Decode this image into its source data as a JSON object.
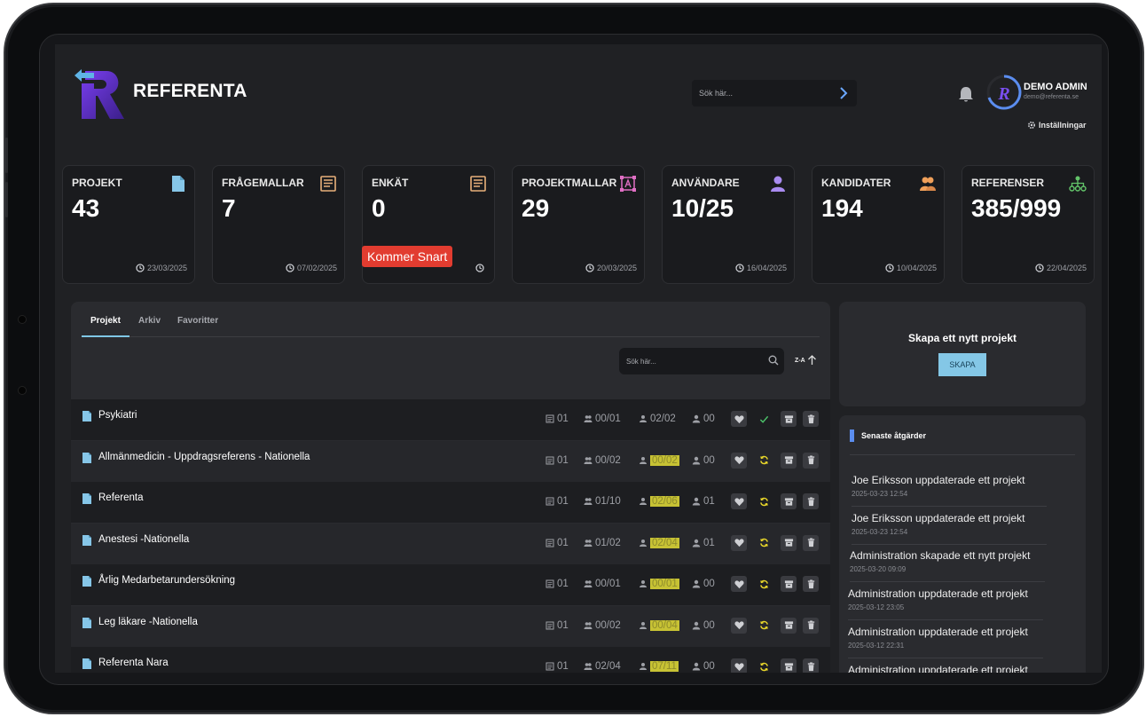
{
  "brand": {
    "name": "REFERENTA",
    "colors": {
      "accent": "#7fc7e6",
      "purple": "#6d3fd1",
      "highlight": "#c7c234",
      "soon": "#e23c30"
    }
  },
  "header": {
    "search_placeholder": "Sök här...",
    "user_name": "DEMO ADMIN",
    "user_email": "demo@referenta.se",
    "settings_label": "Inställningar"
  },
  "stats": [
    {
      "label": "PROJEKT",
      "value": "43",
      "date": "23/03/2025",
      "icon": "document-icon"
    },
    {
      "label": "FRÅGEMALLAR",
      "value": "7",
      "date": "07/02/2025",
      "icon": "form-icon"
    },
    {
      "label": "ENKÄT",
      "value": "0",
      "date": "",
      "icon": "form-icon",
      "badge": "Kommer Snart"
    },
    {
      "label": "PROJEKTMALLAR",
      "value": "29",
      "date": "20/03/2025",
      "icon": "template-icon"
    },
    {
      "label": "ANVÄNDARE",
      "value": "10/25",
      "date": "16/04/2025",
      "icon": "user-icon"
    },
    {
      "label": "KANDIDATER",
      "value": "194",
      "date": "10/04/2025",
      "icon": "candidates-icon"
    },
    {
      "label": "REFERENSER",
      "value": "385/999",
      "date": "22/04/2025",
      "icon": "network-icon"
    }
  ],
  "projects_panel": {
    "tabs": [
      {
        "label": "Projekt",
        "active": true
      },
      {
        "label": "Arkiv"
      },
      {
        "label": "Favoritter"
      }
    ],
    "search_placeholder": "Sök här...",
    "sort_label": "Z-A",
    "rows": [
      {
        "name": "Psykiatri",
        "forms": "01",
        "candidates": "00/01",
        "references": "02/02",
        "ref_highlight": false,
        "users": "00",
        "status": "done"
      },
      {
        "name": "Allmänmedicin - Uppdragsreferens - Nationella",
        "forms": "01",
        "candidates": "00/02",
        "references": "00/02",
        "ref_highlight": true,
        "users": "00",
        "status": "pending"
      },
      {
        "name": "Referenta",
        "forms": "01",
        "candidates": "01/10",
        "references": "02/06",
        "ref_highlight": true,
        "users": "01",
        "status": "pending"
      },
      {
        "name": "Anestesi -Nationella",
        "forms": "01",
        "candidates": "01/02",
        "references": "02/04",
        "ref_highlight": true,
        "users": "01",
        "status": "pending"
      },
      {
        "name": "Årlig Medarbetarundersökning",
        "forms": "01",
        "candidates": "00/01",
        "references": "00/01",
        "ref_highlight": true,
        "users": "00",
        "status": "pending"
      },
      {
        "name": "Leg läkare -Nationella",
        "forms": "01",
        "candidates": "00/02",
        "references": "00/04",
        "ref_highlight": true,
        "users": "00",
        "status": "pending"
      },
      {
        "name": "Referenta Nara",
        "forms": "01",
        "candidates": "02/04",
        "references": "07/11",
        "ref_highlight": true,
        "users": "00",
        "status": "pending"
      }
    ]
  },
  "create_panel": {
    "title": "Skapa ett nytt projekt",
    "button": "SKAPA"
  },
  "recent_panel": {
    "title": "Senaste åtgärder",
    "items": [
      {
        "text": "Joe Eriksson uppdaterade ett projekt",
        "time": "2025-03-23 12:54"
      },
      {
        "text": "Joe Eriksson uppdaterade ett projekt",
        "time": "2025-03-23 12:54"
      },
      {
        "text": "Administration skapade ett nytt projekt",
        "time": "2025-03-20 09:09"
      },
      {
        "text": "Administration uppdaterade ett projekt",
        "time": "2025-03-12 23:05"
      },
      {
        "text": "Administration uppdaterade ett projekt",
        "time": "2025-03-12 22:31"
      },
      {
        "text": "Administration uppdaterade ett projekt",
        "time": ""
      }
    ]
  }
}
